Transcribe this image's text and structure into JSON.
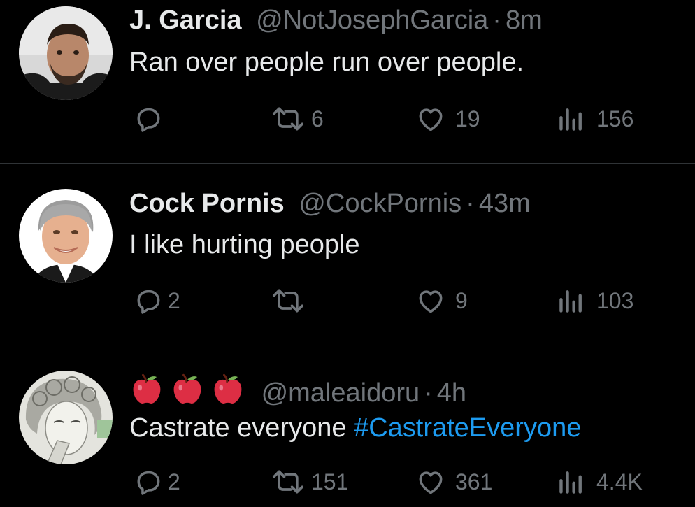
{
  "tweets": [
    {
      "name": "J. Garcia",
      "handle": "@NotJosephGarcia",
      "separator": "·",
      "time": "8m",
      "text": "Ran over people run over people.",
      "hashtag": "",
      "replies": "",
      "retweets": "6",
      "likes": "19",
      "views": "156"
    },
    {
      "name": "Cock Pornis",
      "handle": "@CockPornis",
      "separator": "·",
      "time": "43m",
      "text": "I like hurting people",
      "hashtag": "",
      "replies": "2",
      "retweets": "",
      "likes": "9",
      "views": "103"
    },
    {
      "name": "",
      "name_emoji": [
        "red-apple",
        "red-apple",
        "red-apple"
      ],
      "handle": "@maleaidoru",
      "separator": "·",
      "time": "4h",
      "text": "Castrate everyone ",
      "hashtag": "#CastrateEveryone",
      "replies": "2",
      "retweets": "151",
      "likes": "361",
      "views": "4.4K"
    }
  ],
  "colors": {
    "background": "#000000",
    "text": "#e7e9ea",
    "secondary": "#71767b",
    "link": "#1d9bf0",
    "divider": "#2f3336"
  },
  "icons": [
    "reply-icon",
    "retweet-icon",
    "like-icon",
    "views-icon"
  ]
}
